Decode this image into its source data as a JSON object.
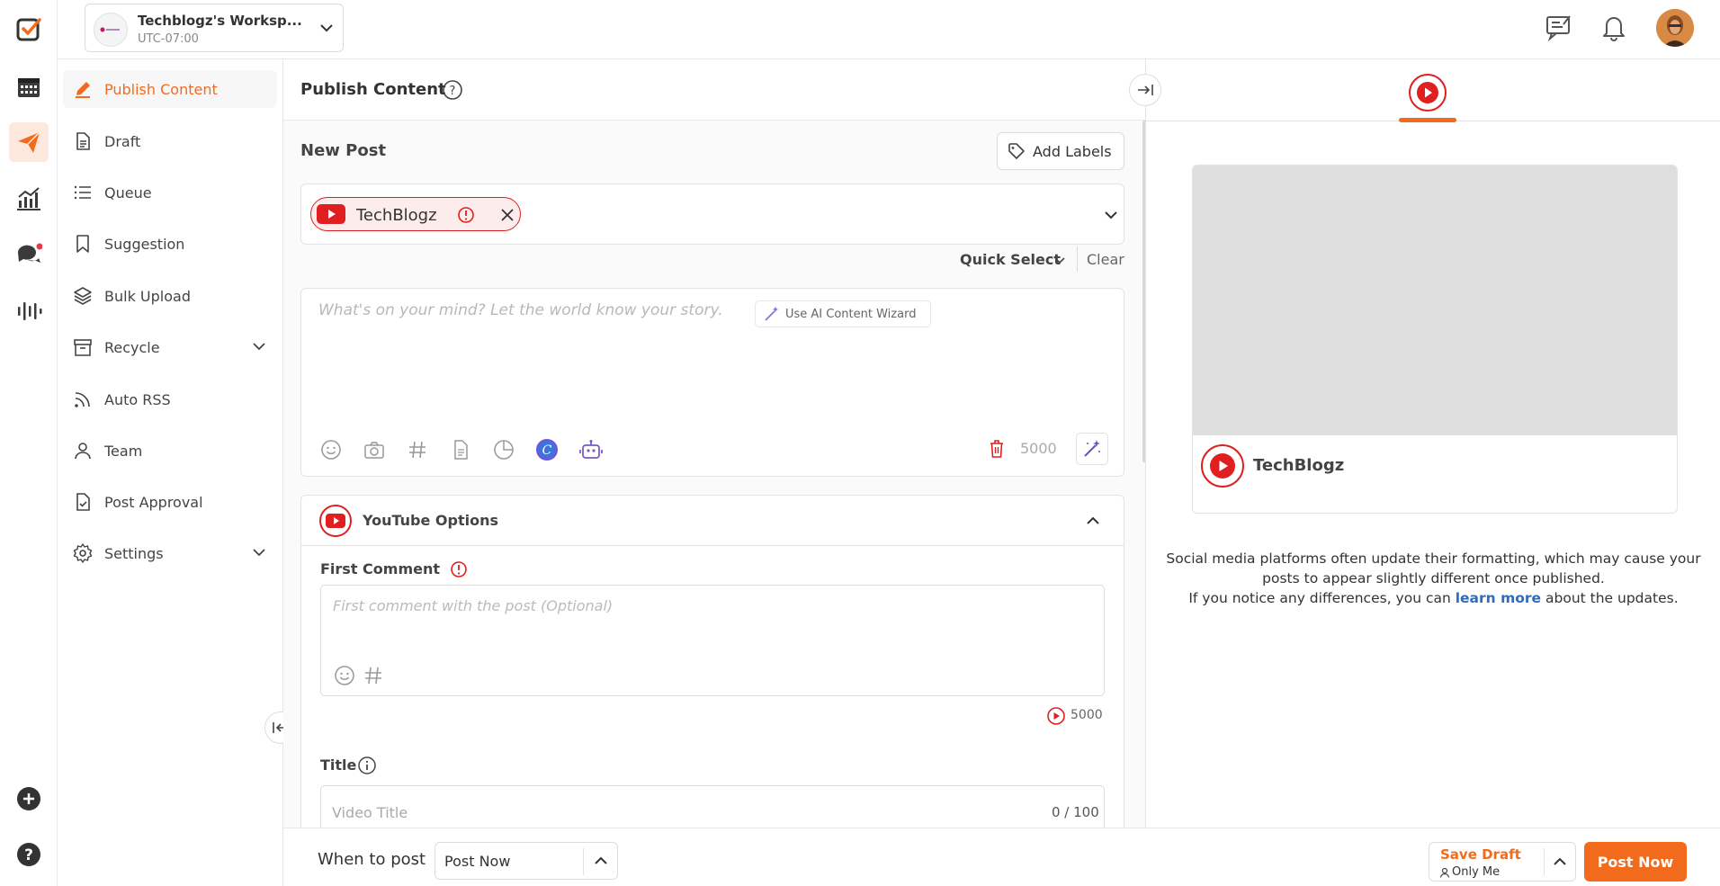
{
  "workspace": {
    "name": "Techblogz's Worksp...",
    "timezone": "UTC-07:00"
  },
  "sidebar": {
    "items": [
      {
        "label": "Publish Content",
        "icon": "pen-icon",
        "active": true
      },
      {
        "label": "Draft",
        "icon": "document-icon"
      },
      {
        "label": "Queue",
        "icon": "list-icon"
      },
      {
        "label": "Suggestion",
        "icon": "bookmark-icon"
      },
      {
        "label": "Bulk Upload",
        "icon": "layers-icon"
      },
      {
        "label": "Recycle",
        "icon": "archive-icon",
        "expandable": true
      },
      {
        "label": "Auto RSS",
        "icon": "rss-icon"
      },
      {
        "label": "Team",
        "icon": "user-icon"
      },
      {
        "label": "Post Approval",
        "icon": "approval-icon"
      },
      {
        "label": "Settings",
        "icon": "gear-icon",
        "expandable": true
      }
    ]
  },
  "header": {
    "title": "Publish Content"
  },
  "post": {
    "heading": "New Post",
    "add_labels": "Add Labels",
    "account_name": "TechBlogz",
    "quick_select": "Quick Select",
    "clear": "Clear",
    "placeholder": "What's on your mind? Let the world know your story.",
    "ai_wizard": "Use AI Content Wizard",
    "char_count": "5000"
  },
  "youtube_options": {
    "title": "YouTube Options",
    "first_comment_label": "First Comment",
    "first_comment_placeholder": "First comment with the post (Optional)",
    "first_comment_count": "5000",
    "title_label": "Title",
    "video_title_placeholder": "Video Title",
    "title_counter": "0 / 100"
  },
  "preview": {
    "account_name": "TechBlogz",
    "notice_line1": "Social media platforms often update their formatting, which may cause your",
    "notice_line2": "posts to appear slightly different once published.",
    "notice_line3_pre": "If you notice any differences, you can",
    "notice_link": "learn more",
    "notice_line3_post": "about the updates."
  },
  "bottom": {
    "when_label": "When to post",
    "when_value": "Post Now",
    "save_draft": "Save Draft",
    "visibility": "Only Me",
    "post_now": "Post Now"
  },
  "colors": {
    "accent": "#f26b1d",
    "youtube": "#e02020",
    "link": "#2d6cc0"
  }
}
